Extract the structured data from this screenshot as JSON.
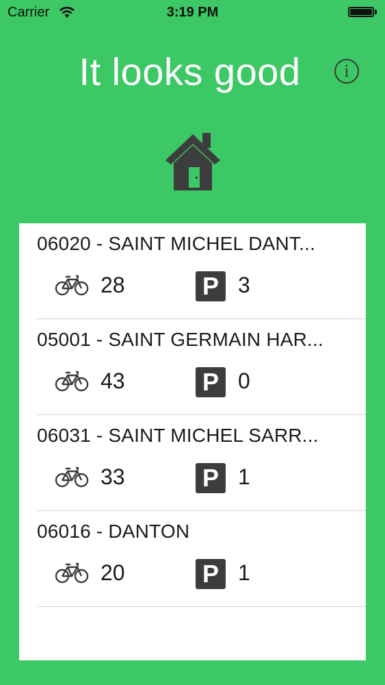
{
  "status_bar": {
    "carrier": "Carrier",
    "time": "3:19 PM"
  },
  "header": {
    "title": "It looks good",
    "info_glyph": "i"
  },
  "icons": {
    "home": "house-icon",
    "info": "info-circle-icon",
    "bike": "bicycle-icon",
    "parking": "parking-icon"
  },
  "parking_glyph": "P",
  "colors": {
    "background": "#3cc864",
    "card": "#ffffff",
    "icon_dark": "#3d3d3d"
  },
  "stations": [
    {
      "name": "06020 - SAINT MICHEL DANT...",
      "bikes": "28",
      "parking": "3"
    },
    {
      "name": "05001 - SAINT GERMAIN HAR...",
      "bikes": "43",
      "parking": "0"
    },
    {
      "name": "06031 - SAINT MICHEL SARR...",
      "bikes": "33",
      "parking": "1"
    },
    {
      "name": "06016 - DANTON",
      "bikes": "20",
      "parking": "1"
    }
  ]
}
